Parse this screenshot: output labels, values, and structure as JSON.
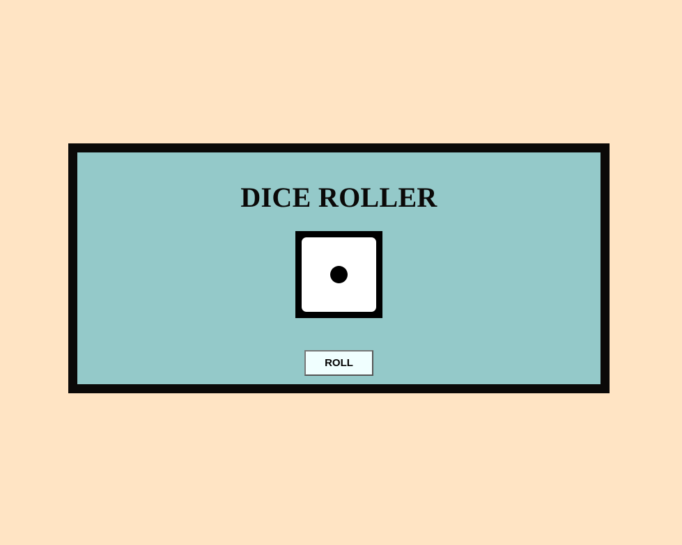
{
  "app": {
    "title": "DICE ROLLER"
  },
  "die": {
    "value": 1
  },
  "controls": {
    "roll_label": "ROLL"
  },
  "colors": {
    "page_background": "#FFE4C4",
    "panel_background": "#94C9C9",
    "panel_border": "#0B0908",
    "die_face": "#FFFFFF",
    "die_border": "#000000",
    "button_background": "#F0FFFF"
  }
}
